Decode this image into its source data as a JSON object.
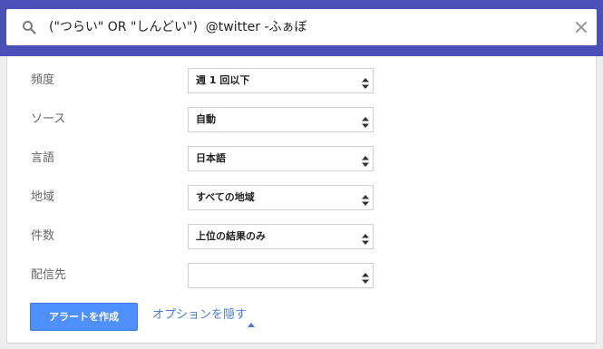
{
  "search": {
    "query": "(\"つらい\" OR \"しんどい\")  @twitter -ふぁぼ",
    "search_icon": "search-icon",
    "clear_icon": "close-icon"
  },
  "options": [
    {
      "label": "頻度",
      "value": "週 1 回以下"
    },
    {
      "label": "ソース",
      "value": "自動"
    },
    {
      "label": "言語",
      "value": "日本語"
    },
    {
      "label": "地域",
      "value": "すべての地域"
    },
    {
      "label": "件数",
      "value": "上位の結果のみ"
    },
    {
      "label": "配信先",
      "value": ""
    }
  ],
  "actions": {
    "create_label": "アラートを作成",
    "hide_options_label": "オプションを隠す",
    "hide_options_icon": "caret-up-icon"
  },
  "colors": {
    "header_bg": "#4b50b8",
    "primary_button": "#4d90fe",
    "link": "#4a7fd6"
  }
}
